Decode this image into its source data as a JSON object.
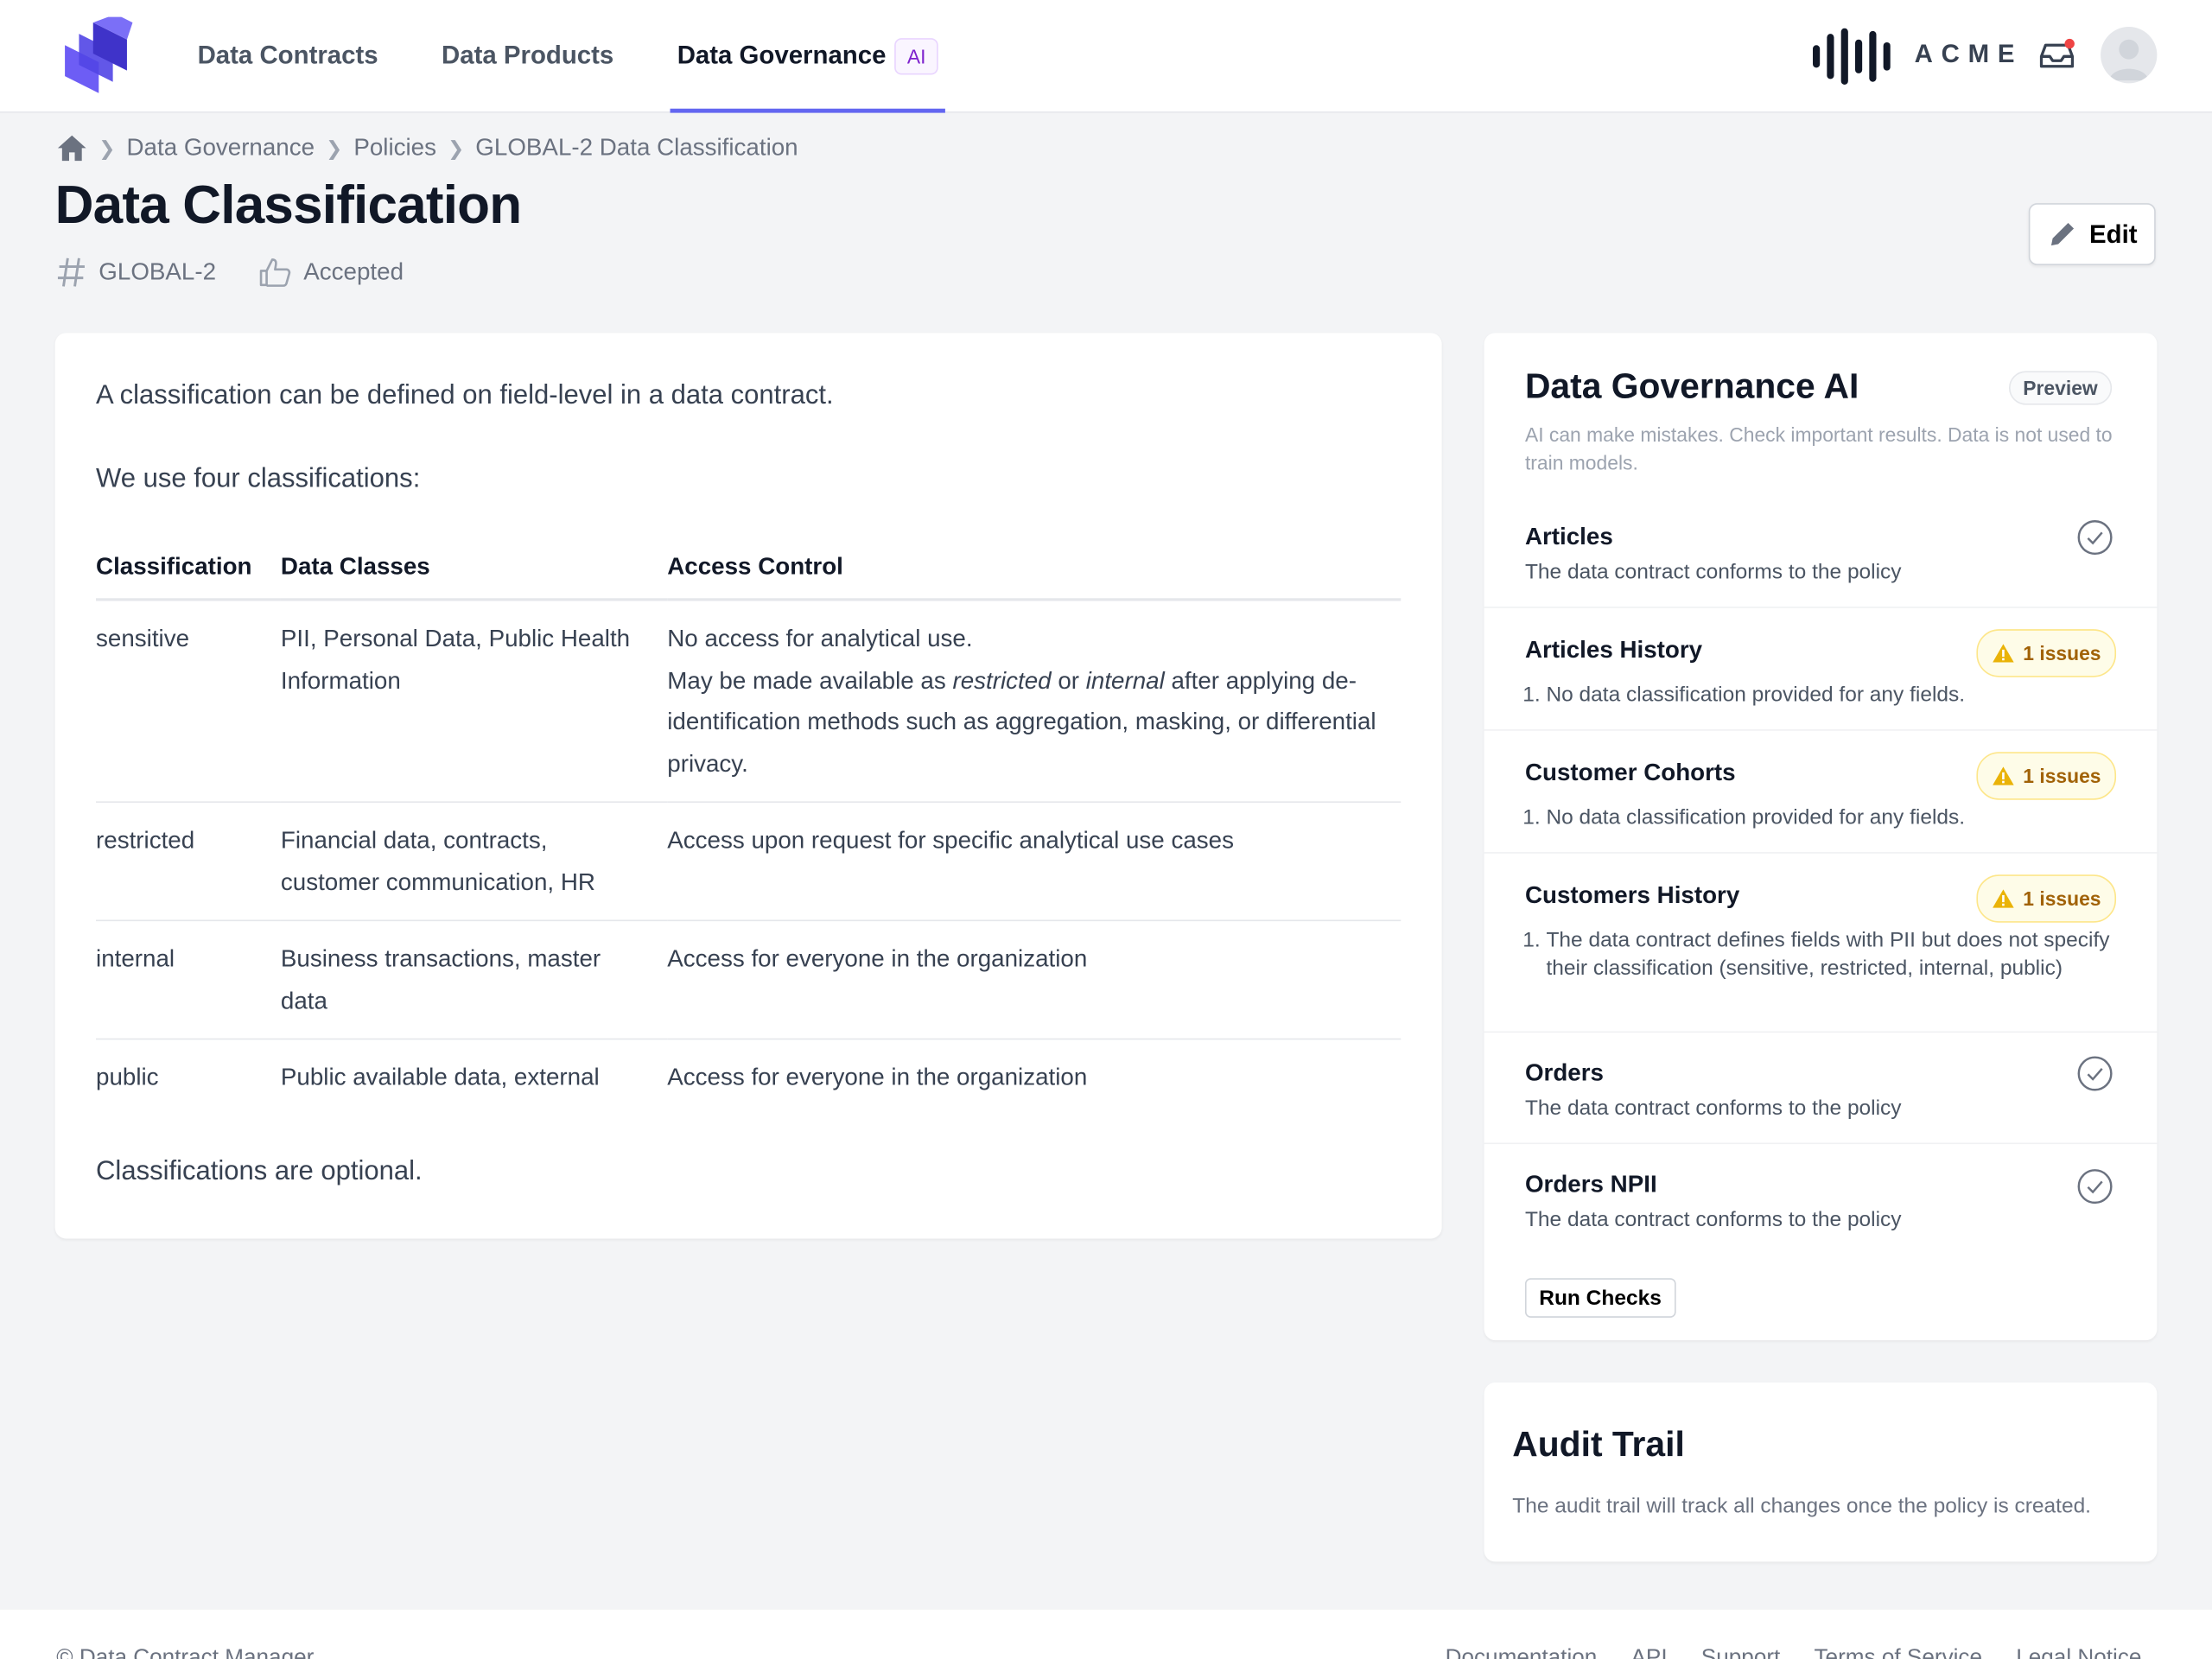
{
  "nav": {
    "tabs": [
      {
        "label": "Data Contracts"
      },
      {
        "label": "Data Products"
      },
      {
        "label": "Data Governance",
        "badge": "AI",
        "active": true
      }
    ],
    "brand": "ACME",
    "colors": {
      "accent": "#6366f1",
      "ai_badge": "#7e22ce",
      "notification_dot": "#ef4444"
    }
  },
  "breadcrumb": [
    "Data Governance",
    "Policies",
    "GLOBAL-2 Data Classification"
  ],
  "page": {
    "title": "Data Classification",
    "id": "GLOBAL-2",
    "status": "Accepted",
    "edit_label": "Edit"
  },
  "content": {
    "intro": "A classification can be defined on field-level in a data contract.",
    "lead": "We use four classifications:",
    "table": {
      "headers": [
        "Classification",
        "Data Classes",
        "Access Control"
      ],
      "rows": [
        {
          "classification": "sensitive",
          "data_classes": "PII, Personal Data, Public Health Information",
          "access_line1": "No access for analytical use.",
          "access_pre": "May be made available as ",
          "access_em1": "restricted",
          "access_mid": " or ",
          "access_em2": "internal",
          "access_post": " after applying de-identification methods such as aggregation, masking, or differential privacy."
        },
        {
          "classification": "restricted",
          "data_classes": "Financial data, contracts, customer communication, HR",
          "access": "Access upon request for specific analytical use cases"
        },
        {
          "classification": "internal",
          "data_classes": "Business transactions, master data",
          "access": "Access for everyone in the organization"
        },
        {
          "classification": "public",
          "data_classes": "Public available data, external",
          "access": "Access for everyone in the organization"
        }
      ]
    },
    "outro": "Classifications are optional."
  },
  "ai": {
    "title": "Data Governance AI",
    "badge": "Preview",
    "disclaimer": "AI can make mistakes. Check important results. Data is not used to train models.",
    "checks": [
      {
        "name": "Articles",
        "status": "ok",
        "desc": "The data contract conforms to the policy"
      },
      {
        "name": "Articles History",
        "status": "issues",
        "issues_label": "1 issues",
        "issues": [
          "No data classification provided for any fields."
        ]
      },
      {
        "name": "Customer Cohorts",
        "status": "issues",
        "issues_label": "1 issues",
        "issues": [
          "No data classification provided for any fields."
        ]
      },
      {
        "name": "Customers History",
        "status": "issues",
        "issues_label": "1 issues",
        "issues": [
          "The data contract defines fields with PII but does not specify their classification (sensitive, restricted, internal, public)"
        ]
      },
      {
        "name": "Orders",
        "status": "ok",
        "desc": "The data contract conforms to the policy"
      },
      {
        "name": "Orders NPII",
        "status": "ok",
        "desc": "The data contract conforms to the policy"
      }
    ],
    "run_label": "Run Checks",
    "colors": {
      "warning": "#eab308",
      "ok": "#6b7280"
    }
  },
  "audit": {
    "title": "Audit Trail",
    "text": "The audit trail will track all changes once the policy is created."
  },
  "footer": {
    "copyright": "© Data Contract Manager",
    "links": [
      "Documentation",
      "API",
      "Support",
      "Terms of Service",
      "Legal Notice"
    ]
  }
}
